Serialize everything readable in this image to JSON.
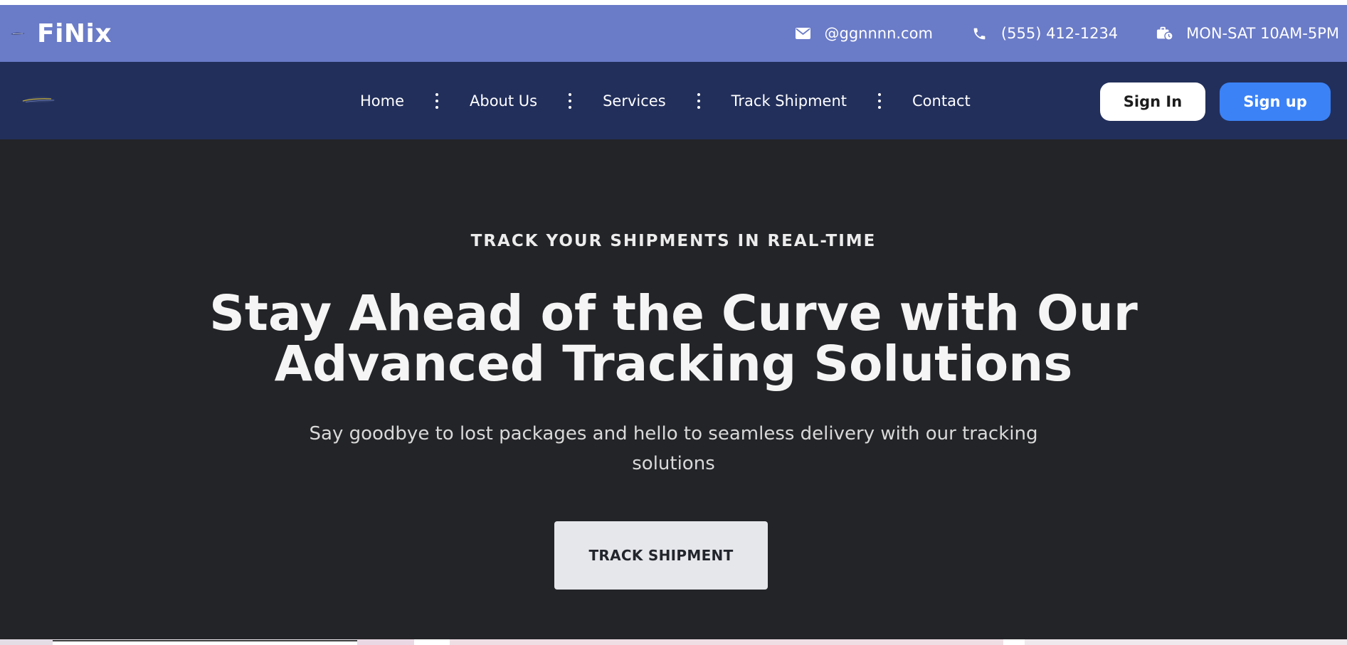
{
  "brand": {
    "name": "FiNix"
  },
  "contact": {
    "email": "@ggnnnn.com",
    "phone": "(555) 412-1234",
    "hours": "MON-SAT 10AM-5PM"
  },
  "nav": {
    "links": [
      "Home",
      "About Us",
      "Services",
      "Track Shipment",
      "Contact"
    ],
    "sign_in_label": "Sign In",
    "sign_up_label": "Sign up"
  },
  "hero": {
    "eyebrow": "TRACK YOUR SHIPMENTS IN REAL-TIME",
    "headline_line1": "Stay Ahead of the Curve with Our",
    "headline_line2": "Advanced Tracking Solutions",
    "subtext": "Say goodbye to lost packages and hello to seamless delivery with our tracking solutions",
    "cta_label": "TRACK SHIPMENT"
  },
  "colors": {
    "contact_bar": "#6a7bc8",
    "navbar": "#222f5b",
    "hero_bg": "#232427",
    "signup_button": "#3b82f6",
    "cta_button": "#e6e7eb"
  },
  "icons": {
    "email": "envelope-icon",
    "phone": "phone-icon",
    "hours": "briefcase-clock-icon"
  }
}
